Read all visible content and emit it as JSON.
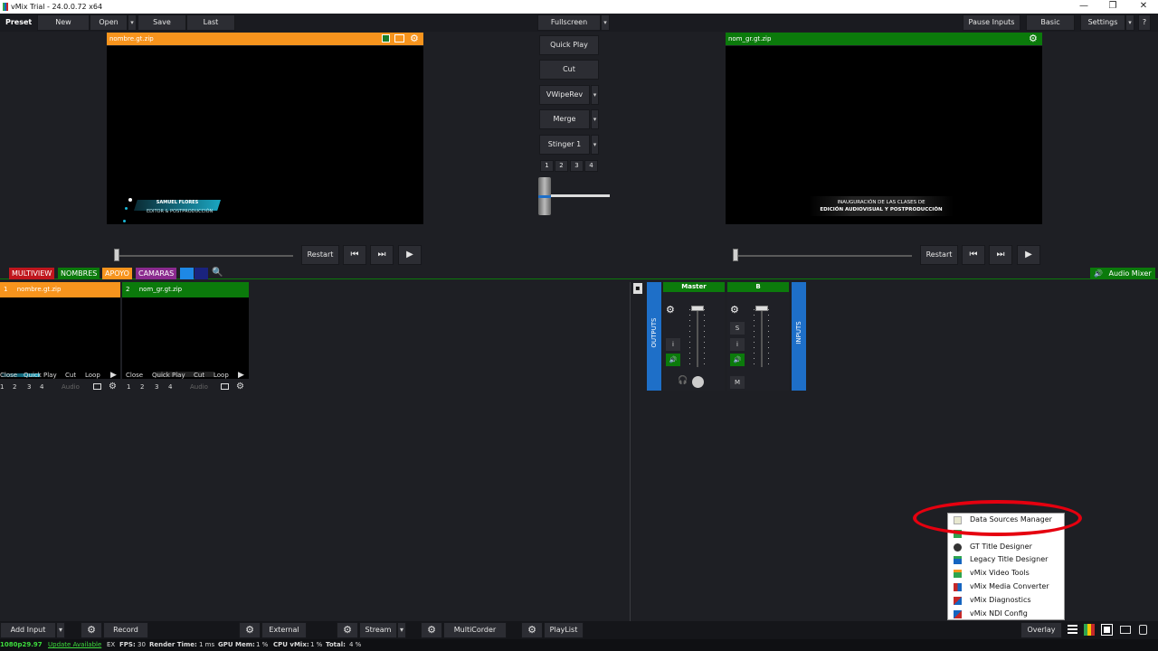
{
  "window": {
    "title": "vMix Trial - 24.0.0.72 x64",
    "minimize_glyph": "—",
    "maximize_glyph": "❐",
    "close_glyph": "✕"
  },
  "toolbar": {
    "preset": "Preset",
    "new": "New",
    "open": "Open",
    "save": "Save",
    "last": "Last",
    "fullscreen": "Fullscreen",
    "pause_inputs": "Pause Inputs",
    "basic": "Basic",
    "settings": "Settings",
    "help": "?",
    "dropdown_glyph": "▾"
  },
  "preview": {
    "title": "nombre.gt.zip",
    "lower_third_line1": "SAMUEL FLORES",
    "lower_third_line2": "EDITOR & POSTPRODUCCIÓN"
  },
  "output": {
    "title": "nom_gr.gt.zip",
    "caption_line1": "INAUGURACIÓN DE LAS CLASES DE",
    "caption_line2": "EDICIÓN AUDIOVISUAL Y POSTPRODUCCIÓN"
  },
  "transitions": {
    "quick_play": "Quick Play",
    "cut": "Cut",
    "t1": "VWipeRev",
    "t2": "Merge",
    "t3": "Stinger 1",
    "numbers": [
      "1",
      "2",
      "3",
      "4"
    ]
  },
  "playback": {
    "restart": "Restart",
    "prev_glyph": "⏮",
    "next_glyph": "⏭",
    "play_glyph": "▶"
  },
  "tags": {
    "multiview": "MULTIVIEW",
    "nombres": "NOMBRES",
    "apoyo": "APOYO",
    "camaras": "CAMARAS",
    "search_glyph": "🔍"
  },
  "inputs": [
    {
      "number": "1",
      "name": "nombre.gt.zip",
      "color": "#f7941d",
      "close": "Close",
      "quick_play": "Quick Play",
      "cut": "Cut",
      "loop": "Loop",
      "audio": "Audio",
      "nums": [
        "1",
        "2",
        "3",
        "4"
      ]
    },
    {
      "number": "2",
      "name": "nom_gr.gt.zip",
      "color": "#0b7a0b",
      "close": "Close",
      "quick_play": "Quick Play",
      "cut": "Cut",
      "loop": "Loop",
      "audio": "Audio",
      "nums": [
        "1",
        "2",
        "3",
        "4"
      ]
    }
  ],
  "audio_mixer": {
    "label": "Audio Mixer",
    "outputs_label": "OUTPUTS",
    "inputs_label": "INPUTS",
    "master": "Master",
    "bus_b": "B",
    "info_btn": "i",
    "solo_btn": "S",
    "mute_btn": "M"
  },
  "menu": {
    "items": [
      "Data Sources Manager",
      "",
      "GT Title Designer",
      "Legacy Title Designer",
      "vMix Video Tools",
      "vMix Media Converter",
      "vMix Diagnostics",
      "vMix NDI Config"
    ]
  },
  "bottom": {
    "add_input": "Add Input",
    "record": "Record",
    "external": "External",
    "stream": "Stream",
    "multicorder": "MultiCorder",
    "playlist": "PlayList",
    "overlay": "Overlay"
  },
  "status": {
    "format": "1080p29.97",
    "update": "Update Available",
    "ex": "EX",
    "fps_label": "FPS:",
    "fps": "30",
    "render_label": "Render Time:",
    "render": "1 ms",
    "gpu_label": "GPU Mem:",
    "gpu": "1 %",
    "cpu_label": "CPU vMix:",
    "cpu": "1 %",
    "total_label": "Total:",
    "total": "4 %"
  },
  "colors": {
    "orange": "#f7941d",
    "green": "#0b7a0b",
    "red_tag": "#c0161d",
    "purple_tag": "#8b2a8f",
    "blue": "#1e6fc8",
    "annotation_red": "#e5000f"
  }
}
